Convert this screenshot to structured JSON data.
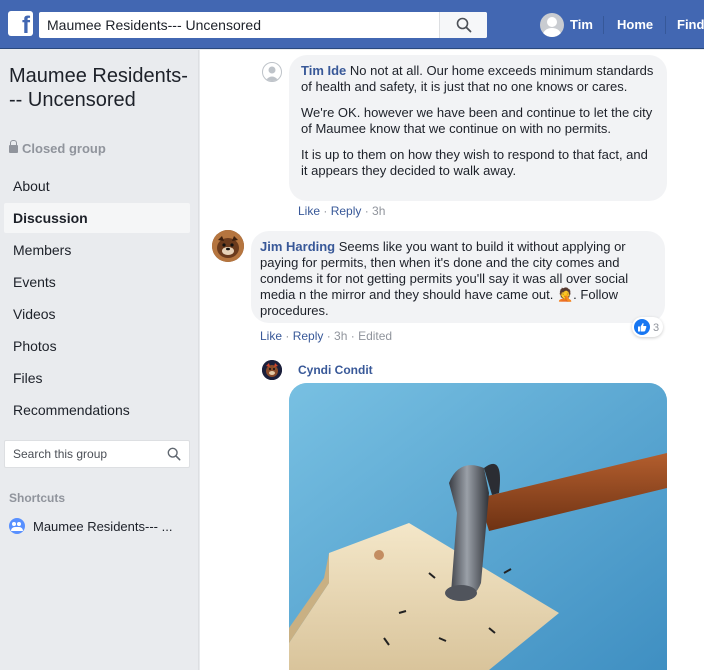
{
  "topbar": {
    "logo": "f",
    "search_value": "Maumee Residents--- Uncensored",
    "user_name": "Tim",
    "home_label": "Home",
    "find_label": "Find"
  },
  "sidebar": {
    "group_title": "Maumee Residents--- Uncensored",
    "privacy": "Closed group",
    "items": [
      {
        "label": "About"
      },
      {
        "label": "Discussion"
      },
      {
        "label": "Members"
      },
      {
        "label": "Events"
      },
      {
        "label": "Videos"
      },
      {
        "label": "Photos"
      },
      {
        "label": "Files"
      },
      {
        "label": "Recommendations"
      }
    ],
    "search_placeholder": "Search this group",
    "shortcuts_heading": "Shortcuts",
    "shortcut_item": "Maumee Residents--- ..."
  },
  "comments": [
    {
      "author": "Tim Ide",
      "paragraphs": [
        "No not at all. Our home exceeds minimum standards of health and safety, it is just that no one knows or cares.",
        "We're OK. however we have been and continue to let the city of Maumee know that we continue on with no permits.",
        "It is up to them on how they wish to respond to that fact, and it appears they decided to walk away."
      ],
      "like": "Like",
      "reply": "Reply",
      "time": "3h"
    },
    {
      "author": "Jim Harding",
      "text": "Seems like you want to build it without applying or paying for permits, then when it's done and the city comes and condems it for not getting permits you'll say it was all over social media n the mirror and they should have came out. 🤦. Follow procedures.",
      "like": "Like",
      "reply": "Reply",
      "time": "3h",
      "edited": "Edited",
      "reaction_count": "3"
    },
    {
      "author": "Cyndi Condit"
    }
  ],
  "colors": {
    "brand": "#4267b2",
    "link": "#385898",
    "meta": "#90949c",
    "bubble": "#f2f3f5"
  }
}
